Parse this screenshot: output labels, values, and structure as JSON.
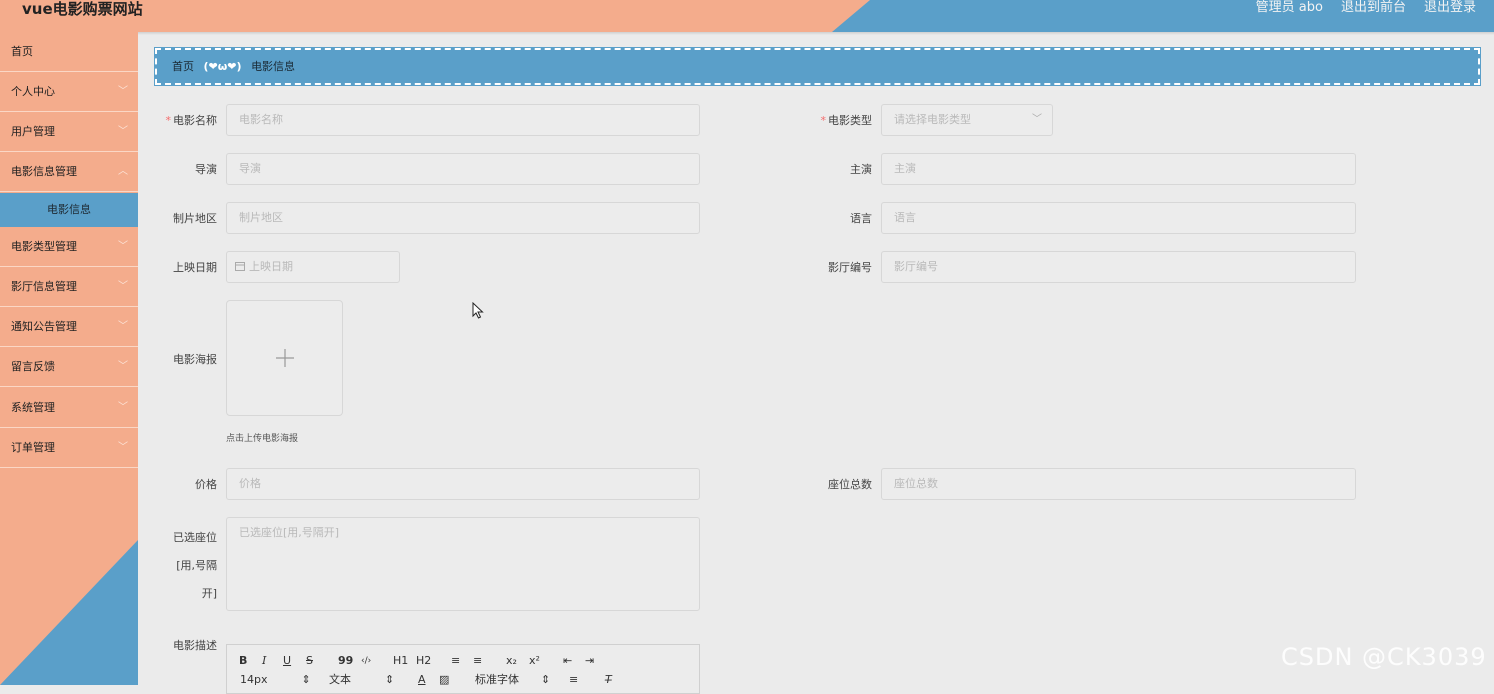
{
  "app": {
    "title": "vue电影购票网站",
    "nav": [
      "管理员 abo",
      "退出到前台",
      "退出登录"
    ]
  },
  "sidebar": {
    "items": [
      {
        "label": "首页",
        "expandable": false
      },
      {
        "label": "个人中心",
        "expandable": true
      },
      {
        "label": "用户管理",
        "expandable": true
      },
      {
        "label": "电影信息管理",
        "expandable": true
      },
      {
        "label": "电影信息",
        "sub": true
      },
      {
        "label": "电影类型管理",
        "expandable": true
      },
      {
        "label": "影厅信息管理",
        "expandable": true
      },
      {
        "label": "通知公告管理",
        "expandable": true
      },
      {
        "label": "留言反馈",
        "expandable": true
      },
      {
        "label": "系统管理",
        "expandable": true
      },
      {
        "label": "订单管理",
        "expandable": true
      }
    ]
  },
  "breadcrumb": {
    "home": "首页",
    "separator": "(❤ω❤)",
    "current": "电影信息"
  },
  "form": {
    "name": {
      "label": "电影名称",
      "placeholder": "电影名称"
    },
    "type": {
      "label": "电影类型",
      "placeholder": "请选择电影类型"
    },
    "director": {
      "label": "导演",
      "placeholder": "导演"
    },
    "actor": {
      "label": "主演",
      "placeholder": "主演"
    },
    "region": {
      "label": "制片地区",
      "placeholder": "制片地区"
    },
    "language": {
      "label": "语言",
      "placeholder": "语言"
    },
    "date": {
      "label": "上映日期",
      "placeholder": "上映日期"
    },
    "hall": {
      "label": "影厅编号",
      "placeholder": "影厅编号"
    },
    "poster": {
      "label": "电影海报",
      "tip": "点击上传电影海报"
    },
    "price": {
      "label": "价格",
      "placeholder": "价格"
    },
    "seats_total": {
      "label": "座位总数",
      "placeholder": "座位总数"
    },
    "selected_seats": {
      "label_lines": [
        "已选座位",
        "[用,号隔",
        "开]"
      ],
      "placeholder": "已选座位[用,号隔开]"
    },
    "description": {
      "label": "电影描述"
    }
  },
  "editor": {
    "row1": [
      "B",
      "I",
      "U",
      "S",
      "99",
      "‹/›",
      "H1",
      "H2",
      "≡",
      "≡",
      "x₂",
      "x²",
      "⇤",
      "⇥"
    ],
    "font_size": "14px",
    "text_style": "文本",
    "font_family": "标准字体"
  },
  "watermark": "CSDN @CK3039",
  "colors": {
    "peach": "#f4ac8c",
    "blue": "#5a9fc9",
    "required": "#f56c6c"
  }
}
